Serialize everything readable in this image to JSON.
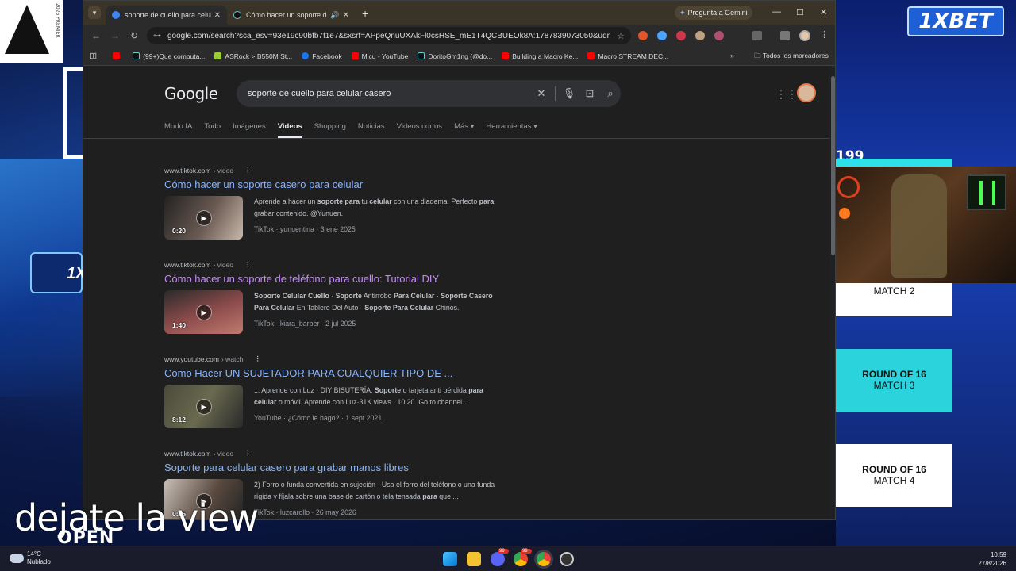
{
  "stream": {
    "overlay_text": "dejate la view",
    "open_logo": "OPEN",
    "sponsor": "1XBET",
    "score_num": "199",
    "left_logo_side": "2026 PREMIER",
    "left_card_text": "1X",
    "match_cards": [
      {
        "round": "",
        "match": "MATCH 2"
      },
      {
        "round": "ROUND OF 16",
        "match": "MATCH 3"
      },
      {
        "round": "ROUND OF 16",
        "match": "MATCH 4"
      }
    ]
  },
  "browser": {
    "tabs": [
      {
        "title": "soporte de cuello para celular c",
        "active": true,
        "icon": "google-icon"
      },
      {
        "title": "Cómo hacer un soporte de",
        "active": false,
        "icon": "tiktok-icon"
      }
    ],
    "gemini_label": "Pregunta a Gemini",
    "url": "google.com/search?sca_esv=93e19c90bfb7f1e7&sxsrf=APpeQnuUXAkFl0csHSE_mE1T4QCBUEOk8A:1787839073050&udm=7&fbs=...",
    "bookmarks": [
      {
        "label": "",
        "color": "#ff0000"
      },
      {
        "label": "(99+)Que computa...",
        "color": "#111111"
      },
      {
        "label": "ASRock > B550M St...",
        "color": "#9acd32"
      },
      {
        "label": "Facebook",
        "color": "#1877f2"
      },
      {
        "label": "Micu - YouTube",
        "color": "#ff0000"
      },
      {
        "label": "DoritoGm1ng (@do...",
        "color": "#111111"
      },
      {
        "label": "Building a Macro Ke...",
        "color": "#ff0000"
      },
      {
        "label": "Macro STREAM DEC...",
        "color": "#ff0000"
      }
    ],
    "bookmarks_all": "Todos los marcadores"
  },
  "google": {
    "logo": "Google",
    "query": "soporte de cuello para celular casero",
    "tabs": [
      "Modo IA",
      "Todo",
      "Imágenes",
      "Videos",
      "Shopping",
      "Noticias",
      "Videos cortos",
      "Más ▾",
      "Herramientas ▾"
    ],
    "active_tab": "Videos",
    "results": [
      {
        "source": "www.tiktok.com",
        "path": "› video",
        "title": "Cómo hacer un soporte casero para celular",
        "visited": false,
        "duration": "0:20",
        "snippet": "Aprende a hacer un soporte para tu celular con una diadema. Perfecto para grabar contenido. @Yunuen.",
        "meta": "TikTok · yunuentina · 3 ene 2025",
        "thumb_color": "#4a4040"
      },
      {
        "source": "www.tiktok.com",
        "path": "› video",
        "title": "Cómo hacer un soporte de teléfono para cuello: Tutorial DIY",
        "visited": true,
        "duration": "1:40",
        "snippet": "Soporte Celular Cuello · Soporte Antirrobo Para Celular · Soporte Casero Para Celular En Tablero Del Auto · Soporte Para Celular Chinos.",
        "meta": "TikTok · kiara_barber · 2 jul 2025",
        "thumb_color": "#7a3a3a"
      },
      {
        "source": "www.youtube.com",
        "path": "› watch",
        "title": "Como Hacer UN SUJETADOR PARA CUALQUIER TIPO DE ...",
        "visited": false,
        "duration": "8:12",
        "snippet": "... Aprende con Luz · DIY BISUTERÍA: Soporte o tarjeta anti pérdida para celular o móvil. Aprende con Luz·31K views · 10:20. Go to channel...",
        "meta": "YouTube · ¿Cómo le hago? · 1 sept 2021",
        "thumb_color": "#3a3a2a"
      },
      {
        "source": "www.tiktok.com",
        "path": "› video",
        "title": "Soporte para celular casero para grabar manos libres",
        "visited": false,
        "duration": "0:25",
        "snippet": "2) Forro o funda convertida en sujeción - Usa el forro del teléfono o una funda rígida y fíjala sobre una base de cartón o tela tensada para que ...",
        "meta": "TikTok · luzcarollo · 26 may 2026",
        "thumb_color": "#5a4a40"
      }
    ]
  },
  "taskbar": {
    "temp": "14°C",
    "weather": "Nublado",
    "time": "10:59",
    "date": "27/8/2026",
    "badges": [
      "99+",
      "99+"
    ]
  }
}
